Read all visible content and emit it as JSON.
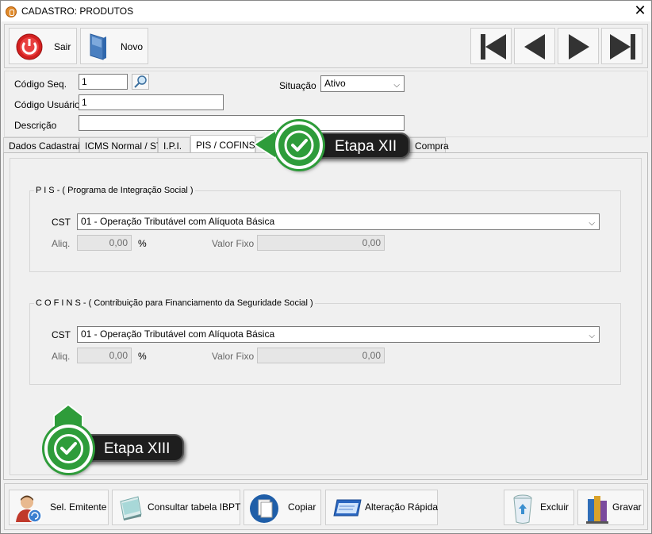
{
  "window": {
    "title": "CADASTRO: PRODUTOS"
  },
  "toolbar": {
    "exit_label": "Sair",
    "new_label": "Novo"
  },
  "form": {
    "seq_code_label": "Código Seq.",
    "seq_code_value": "1",
    "user_code_label": "Código Usuário",
    "user_code_value": "1",
    "description_label": "Descrição",
    "description_value": "",
    "status_label": "Situação",
    "status_value": "Ativo"
  },
  "tabs": [
    {
      "label": "Dados Cadastrais"
    },
    {
      "label": "ICMS Normal / ST"
    },
    {
      "label": "I.P.I."
    },
    {
      "label": "PIS / COFINS"
    },
    {
      "label": "Compra"
    }
  ],
  "pis": {
    "title": "P I S - ( Programa de Integração Social )",
    "cst_label": "CST",
    "cst_value": "01 - Operação Tributável com Alíquota Básica",
    "aliq_label": "Aliq.",
    "aliq_value": "0,00",
    "percent": "%",
    "fixed_label": "Valor Fixo",
    "fixed_value": "0,00"
  },
  "cofins": {
    "title": "C O F I N S - ( Contribuição para Financiamento da Seguridade Social )",
    "cst_label": "CST",
    "cst_value": "01 - Operação Tributável com Alíquota Básica",
    "aliq_label": "Aliq.",
    "aliq_value": "0,00",
    "percent": "%",
    "fixed_label": "Valor Fixo",
    "fixed_value": "0,00"
  },
  "bottom_toolbar": {
    "issuer_label": "Sel. Emitente",
    "ibpt_label": "Consultar tabela IBPT",
    "copy_label": "Copiar",
    "quick_edit_label": "Alteração Rápida",
    "delete_label": "Excluir",
    "save_label": "Gravar"
  },
  "callouts": {
    "step12": "Etapa XII",
    "step13": "Etapa XIII"
  },
  "colors": {
    "callout_green": "#2e9c3a",
    "callout_dark": "#1e1e1e",
    "exit_red": "#d32020"
  }
}
